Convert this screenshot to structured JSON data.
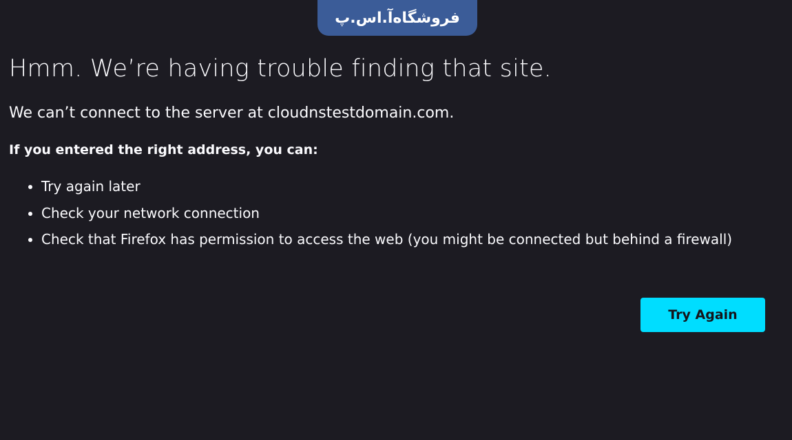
{
  "watermark": {
    "text": "فروشگاه‌آ.اس.پ"
  },
  "error": {
    "title": "Hmm. We’re having trouble finding that site.",
    "description": "We can’t connect to the server at cloudnstestdomain.com.",
    "subheading": "If you entered the right address, you can:",
    "suggestions": [
      "Try again later",
      "Check your network connection",
      "Check that Firefox has permission to access the web (you might be connected but behind a firewall)"
    ]
  },
  "actions": {
    "try_again_label": "Try Again"
  },
  "colors": {
    "background": "#1c1b22",
    "text": "#fbfbfe",
    "accent": "#00ddff",
    "watermark_bg": "#3b5c98"
  }
}
